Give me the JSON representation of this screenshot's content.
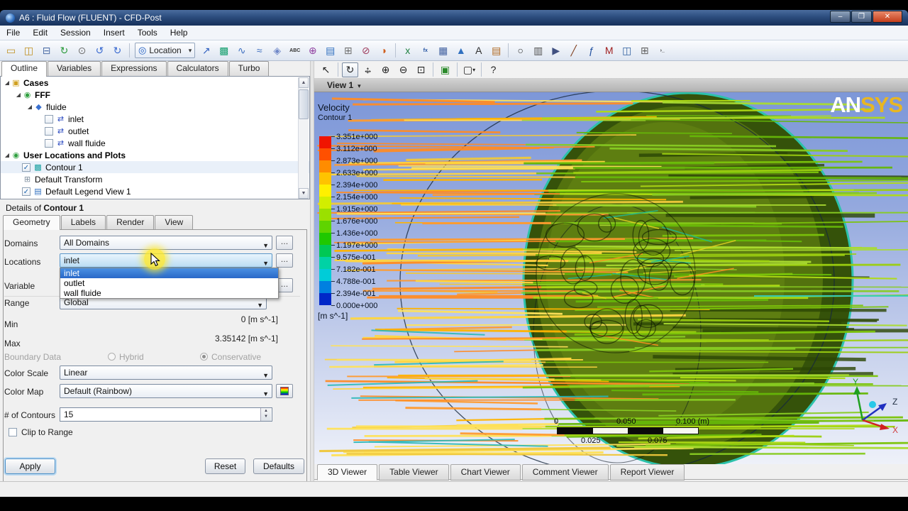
{
  "window": {
    "title": "A6 : Fluid Flow (FLUENT) - CFD-Post",
    "minimize": "–",
    "maximize": "❐",
    "close": "✕"
  },
  "menu": {
    "items": [
      "File",
      "Edit",
      "Session",
      "Insert",
      "Tools",
      "Help"
    ]
  },
  "toolbar": {
    "location": {
      "label": "Location",
      "icon_glyph": "◎",
      "caret": "▾"
    },
    "groups": [
      [
        {
          "name": "new-case-icon",
          "glyph": "▭",
          "color": "#c09020"
        },
        {
          "name": "load-results-icon",
          "glyph": "◫",
          "color": "#c09020"
        },
        {
          "name": "save-state-icon",
          "glyph": "⊟",
          "color": "#5070a8"
        },
        {
          "name": "refresh-icon",
          "glyph": "↻",
          "color": "#2a9a3a"
        },
        {
          "name": "snapshot-icon",
          "glyph": "⊙",
          "color": "#707070"
        },
        {
          "name": "undo-icon",
          "glyph": "↺",
          "color": "#3a6ad0"
        },
        {
          "name": "redo-icon",
          "glyph": "↻",
          "color": "#3a6ad0"
        }
      ],
      [
        {
          "name": "vector-icon",
          "glyph": "↗",
          "color": "#3060c0"
        },
        {
          "name": "contour-icon",
          "glyph": "▩",
          "color": "#18a070"
        },
        {
          "name": "streamline-icon",
          "glyph": "∿",
          "color": "#4070c0"
        },
        {
          "name": "isosurface-icon",
          "glyph": "≈",
          "color": "#4070c0"
        },
        {
          "name": "volume-rendering-icon",
          "glyph": "◈",
          "color": "#7088c8"
        },
        {
          "name": "text-label-icon",
          "glyph": "ABC",
          "color": "#333333",
          "small": true
        },
        {
          "name": "point-icon",
          "glyph": "⊕",
          "color": "#9040a0"
        },
        {
          "name": "legend-icon",
          "glyph": "▤",
          "color": "#3070c0"
        },
        {
          "name": "instance-transform-icon",
          "glyph": "⊞",
          "color": "#707070"
        },
        {
          "name": "clip-plane-icon",
          "glyph": "⊘",
          "color": "#a04060"
        },
        {
          "name": "color-map-edit-icon",
          "glyph": "◑",
          "color": "#d06020"
        }
      ],
      [
        {
          "name": "expression-icon",
          "glyph": "x",
          "color": "#208040"
        },
        {
          "name": "function-calculator-icon",
          "glyph": "fx",
          "color": "#2050a0",
          "small": true
        },
        {
          "name": "table-icon",
          "glyph": "▦",
          "color": "#4060a0"
        },
        {
          "name": "chart-icon",
          "glyph": "▲",
          "color": "#3070c0"
        },
        {
          "name": "comment-icon",
          "glyph": "A",
          "color": "#303030"
        },
        {
          "name": "report-icon",
          "glyph": "▤",
          "color": "#b06820"
        }
      ],
      [
        {
          "name": "timestep-icon",
          "glyph": "○",
          "color": "#303030"
        },
        {
          "name": "animation-icon",
          "glyph": "▥",
          "color": "#505050"
        },
        {
          "name": "quick-animation-icon",
          "glyph": "▶",
          "color": "#405080"
        },
        {
          "name": "probe-icon",
          "glyph": "╱",
          "color": "#804020"
        },
        {
          "name": "calculators-icon",
          "glyph": "ƒ",
          "color": "#2050a0"
        },
        {
          "name": "macro-calculator-icon",
          "glyph": "M",
          "color": "#a02020"
        },
        {
          "name": "report-template-icon",
          "glyph": "◫",
          "color": "#3060a0"
        },
        {
          "name": "views-icon",
          "glyph": "⊞",
          "color": "#606060"
        },
        {
          "name": "command-editor-icon",
          "glyph": "›_",
          "color": "#303030",
          "small": true
        }
      ]
    ]
  },
  "left_tabs": {
    "items": [
      "Outline",
      "Variables",
      "Expressions",
      "Calculators",
      "Turbo"
    ],
    "active": "Outline"
  },
  "tree": {
    "items": [
      {
        "label": "Cases",
        "depth": 0,
        "expander": true,
        "icon": "cases-folder-icon",
        "glyph": "▣",
        "color": "#d0a020",
        "bold": true
      },
      {
        "label": "FFF",
        "depth": 1,
        "expander": true,
        "icon": "case-icon",
        "glyph": "◉",
        "color": "#30a040",
        "bold": true
      },
      {
        "label": "fluide",
        "depth": 2,
        "expander": true,
        "icon": "domain-icon",
        "glyph": "◆",
        "color": "#3a70d0"
      },
      {
        "label": "inlet",
        "depth": 3,
        "checkbox": "unchecked",
        "icon": "boundary-icon",
        "glyph": "⇄",
        "color": "#2848c0"
      },
      {
        "label": "outlet",
        "depth": 3,
        "checkbox": "unchecked",
        "icon": "boundary-icon",
        "glyph": "⇄",
        "color": "#2848c0"
      },
      {
        "label": "wall fluide",
        "depth": 3,
        "checkbox": "unchecked",
        "icon": "boundary-icon",
        "glyph": "⇄",
        "color": "#2848c0"
      },
      {
        "label": "User Locations and Plots",
        "depth": 0,
        "expander": true,
        "icon": "user-locations-icon",
        "glyph": "◉",
        "color": "#30a040",
        "bold": true
      },
      {
        "label": "Contour 1",
        "depth": 1,
        "checkbox": "checked",
        "icon": "contour-icon",
        "glyph": "▩",
        "color": "#18a0a0",
        "selected": true
      },
      {
        "label": "Default Transform",
        "depth": 1,
        "icon": "transform-icon",
        "glyph": "⊞",
        "color": "#8090a0"
      },
      {
        "label": "Default Legend View 1",
        "depth": 1,
        "checkbox": "checked",
        "icon": "legend-icon",
        "glyph": "▤",
        "color": "#3070c0"
      }
    ]
  },
  "details": {
    "title_prefix": "Details of ",
    "title_bold": "Contour 1",
    "tabs": [
      "Geometry",
      "Labels",
      "Render",
      "View"
    ],
    "active_tab": "Geometry"
  },
  "form": {
    "domains": {
      "label": "Domains",
      "value": "All Domains",
      "more": "…"
    },
    "locations": {
      "label": "Locations",
      "value": "inlet",
      "more": "…",
      "options": [
        "inlet",
        "outlet",
        "wall fluide"
      ],
      "selected_option": "inlet"
    },
    "variable": {
      "label": "Variable",
      "more": "…"
    },
    "range": {
      "label": "Range",
      "value": "Global"
    },
    "min": {
      "label": "Min",
      "value": "0 [m s^-1]"
    },
    "max": {
      "label": "Max",
      "value": "3.35142 [m s^-1]"
    },
    "boundary": {
      "label": "Boundary Data",
      "options": [
        "Hybrid",
        "Conservative"
      ],
      "selected": "Conservative"
    },
    "color_scale": {
      "label": "Color Scale",
      "value": "Linear"
    },
    "color_map": {
      "label": "Color Map",
      "value": "Default (Rainbow)"
    },
    "contours": {
      "label": "# of Contours",
      "value": "15"
    },
    "clip": {
      "label": "Clip to Range",
      "checked": false
    },
    "buttons": {
      "apply": "Apply",
      "reset": "Reset",
      "defaults": "Defaults"
    }
  },
  "viewer": {
    "toolbar": [
      {
        "name": "select-icon",
        "glyph": "↖"
      },
      {
        "name": "rotate-icon",
        "glyph": "↻",
        "active": true
      },
      {
        "name": "pan-icon",
        "glyph": "pan"
      },
      {
        "name": "zoom-in-icon",
        "glyph": "⊕"
      },
      {
        "name": "zoom-out-icon",
        "glyph": "⊖"
      },
      {
        "name": "zoom-area-icon",
        "glyph": "⊡"
      },
      {
        "name": "fit-view-icon",
        "glyph": "▣",
        "green": true
      },
      {
        "name": "viewport-layout-icon",
        "glyph": "▢",
        "caret": "▾"
      },
      {
        "name": "viewer-help-icon",
        "glyph": "?"
      }
    ],
    "view_label": "View 1",
    "view_caret": "▾",
    "legend": {
      "title": "Velocity",
      "subtitle": "Contour 1",
      "unit": "[m s^-1]",
      "values": [
        "3.351e+000",
        "3.112e+000",
        "2.873e+000",
        "2.633e+000",
        "2.394e+000",
        "2.154e+000",
        "1.915e+000",
        "1.676e+000",
        "1.436e+000",
        "1.197e+000",
        "9.575e-001",
        "7.182e-001",
        "4.788e-001",
        "2.394e-001",
        "0.000e+000"
      ],
      "band_colors": [
        "#f01400",
        "#ff5000",
        "#ff8c00",
        "#ffc300",
        "#fff000",
        "#d2ee00",
        "#9be000",
        "#5fd400",
        "#1fc800",
        "#00c855",
        "#00d2a5",
        "#00ccd8",
        "#0080e0",
        "#0028c8"
      ]
    },
    "logo": {
      "part1": "AN",
      "part2": "SYS"
    },
    "ruler": {
      "zero": "0",
      "mid": "0.050",
      "end": "0.100 (m)",
      "q1": "0.025",
      "q3": "0.075"
    },
    "triad": {
      "x": "X",
      "y": "Y",
      "z": "Z"
    },
    "tabs": {
      "items": [
        "3D Viewer",
        "Table Viewer",
        "Chart Viewer",
        "Comment Viewer",
        "Report Viewer"
      ],
      "active": "3D Viewer"
    }
  }
}
